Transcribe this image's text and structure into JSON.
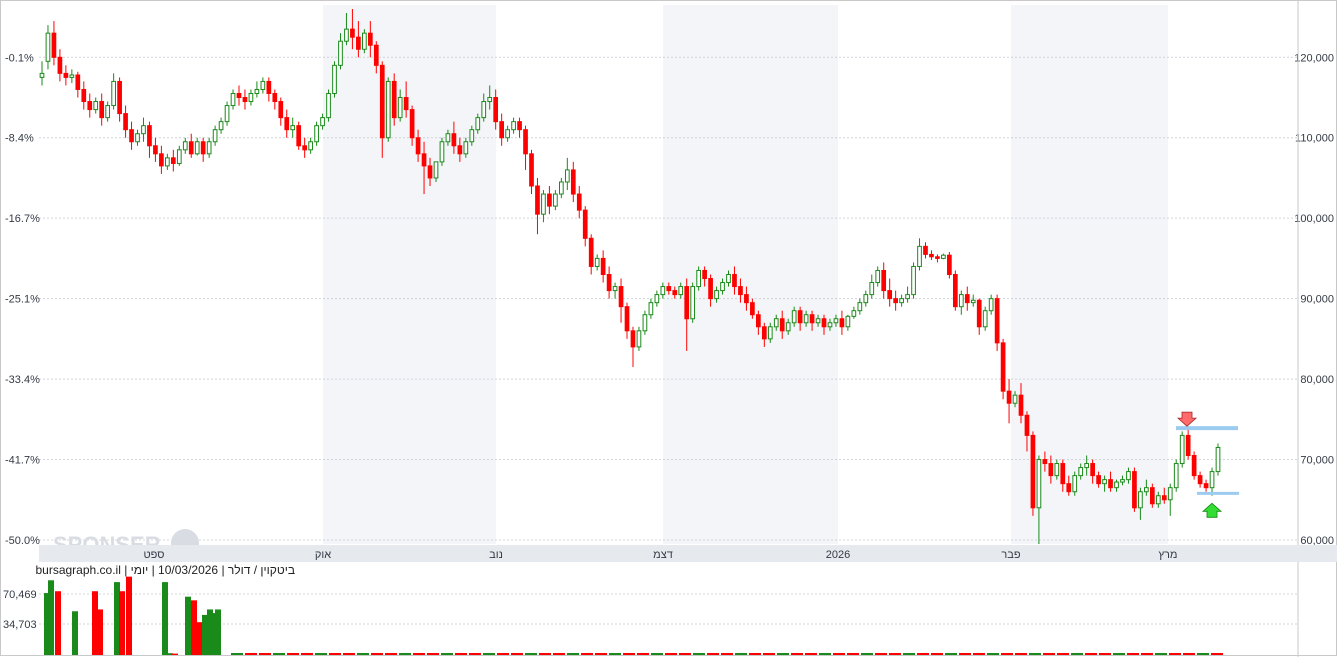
{
  "caption": "bursagraph.co.il | ביטקוין / דולר | 10/03/2026 | יומי",
  "watermark": "SPONSER",
  "colors": {
    "up": "#1a8a1a",
    "down": "#ff0000",
    "grid": "#d0d4da",
    "band": "#f3f5f8",
    "level": "#9ccbf0",
    "arrow_down": "#ff6b6b",
    "arrow_up": "#33dd33"
  },
  "chart_data": {
    "type": "candlestick",
    "ylim": [
      59500,
      126500
    ],
    "y_ticks_right": [
      "60,000",
      "70,000",
      "80,000",
      "90,000",
      "100,000",
      "110,000",
      "120,000"
    ],
    "y_ticks_left": [
      "-50.0%",
      "-41.7%",
      "-33.4%",
      "-25.1%",
      "-16.7%",
      "-8.4%",
      "-0.1%"
    ],
    "x_ticks": [
      "ספט",
      "אוק",
      "נוב",
      "דצמ",
      "2026",
      "פבר",
      "מרץ"
    ],
    "volume_ticks": [
      "70,469",
      "34,703"
    ],
    "levels": [
      73900,
      65800
    ],
    "candles": [
      [
        117500,
        119500,
        118000,
        116500
      ],
      [
        119500,
        124000,
        123000,
        118500
      ],
      [
        123000,
        124500,
        120000,
        119000
      ],
      [
        120000,
        121000,
        118000,
        117000
      ],
      [
        118000,
        119000,
        117500,
        116500
      ],
      [
        117500,
        118500,
        117800,
        116800
      ],
      [
        117800,
        118200,
        116000,
        115000
      ],
      [
        116000,
        117000,
        114500,
        113500
      ],
      [
        114500,
        115500,
        113500,
        112500
      ],
      [
        113500,
        115000,
        114500,
        113000
      ],
      [
        114500,
        115500,
        112500,
        111500
      ],
      [
        112500,
        114500,
        114000,
        112000
      ],
      [
        114000,
        118000,
        117000,
        113500
      ],
      [
        117000,
        117500,
        113000,
        112000
      ],
      [
        113000,
        114000,
        111000,
        110000
      ],
      [
        111000,
        112000,
        109500,
        108500
      ],
      [
        109500,
        111000,
        110500,
        109000
      ],
      [
        110500,
        112500,
        111500,
        109500
      ],
      [
        111500,
        112000,
        109000,
        107500
      ],
      [
        109000,
        110000,
        108000,
        107000
      ],
      [
        108000,
        109000,
        106500,
        105500
      ],
      [
        106500,
        108000,
        107500,
        106000
      ],
      [
        107500,
        108500,
        106800,
        105800
      ],
      [
        106800,
        109000,
        108500,
        106500
      ],
      [
        108500,
        110000,
        109500,
        108000
      ],
      [
        109500,
        110500,
        108000,
        107500
      ],
      [
        108000,
        110000,
        109500,
        107800
      ],
      [
        109500,
        110000,
        108000,
        107000
      ],
      [
        108000,
        110000,
        109500,
        107500
      ],
      [
        109500,
        111500,
        111000,
        109000
      ],
      [
        111000,
        112500,
        112000,
        110500
      ],
      [
        112000,
        114500,
        114000,
        111500
      ],
      [
        114000,
        116000,
        115500,
        113500
      ],
      [
        115500,
        116500,
        115000,
        114000
      ],
      [
        115000,
        116000,
        114500,
        113500
      ],
      [
        114500,
        116000,
        115500,
        114000
      ],
      [
        115500,
        117000,
        116000,
        115000
      ],
      [
        116000,
        117500,
        117000,
        115500
      ],
      [
        117000,
        117500,
        115500,
        114500
      ],
      [
        115500,
        116000,
        114500,
        113500
      ],
      [
        114500,
        115000,
        112500,
        111500
      ],
      [
        112500,
        113500,
        111000,
        110000
      ],
      [
        111000,
        112500,
        111500,
        110000
      ],
      [
        111500,
        112000,
        109000,
        108500
      ],
      [
        109000,
        110000,
        108500,
        107500
      ],
      [
        108500,
        110000,
        109500,
        108000
      ],
      [
        109500,
        112000,
        111500,
        109000
      ],
      [
        111500,
        113000,
        112500,
        111000
      ],
      [
        112500,
        116000,
        115500,
        112000
      ],
      [
        115500,
        119500,
        119000,
        115000
      ],
      [
        119000,
        123000,
        122000,
        118500
      ],
      [
        122000,
        125500,
        123500,
        121500
      ],
      [
        123500,
        126000,
        122500,
        121000
      ],
      [
        122500,
        124500,
        121000,
        120000
      ],
      [
        121000,
        123500,
        123000,
        120500
      ],
      [
        123000,
        124500,
        121500,
        120000
      ],
      [
        121500,
        122000,
        119000,
        118000
      ],
      [
        119000,
        119500,
        110000,
        107500
      ],
      [
        110000,
        117500,
        117000,
        109500
      ],
      [
        117000,
        118000,
        112500,
        111500
      ],
      [
        112500,
        116000,
        115000,
        112000
      ],
      [
        115000,
        117000,
        113500,
        112500
      ],
      [
        113500,
        114000,
        110000,
        109000
      ],
      [
        110000,
        111000,
        108000,
        107000
      ],
      [
        108000,
        109500,
        106500,
        103000
      ],
      [
        106500,
        107500,
        105000,
        104000
      ],
      [
        105000,
        106000,
        107000,
        104500
      ],
      [
        107000,
        110000,
        109500,
        106500
      ],
      [
        109500,
        111000,
        110500,
        109000
      ],
      [
        110500,
        112000,
        109000,
        108000
      ],
      [
        109000,
        110000,
        108000,
        107000
      ],
      [
        108000,
        110000,
        109500,
        107500
      ],
      [
        109500,
        111500,
        111000,
        109000
      ],
      [
        111000,
        113000,
        112500,
        110500
      ],
      [
        112500,
        115500,
        114500,
        112000
      ],
      [
        114500,
        116500,
        115000,
        113500
      ],
      [
        115000,
        116000,
        112000,
        111000
      ],
      [
        112000,
        113000,
        110000,
        109000
      ],
      [
        110000,
        111500,
        111000,
        109500
      ],
      [
        111000,
        112500,
        112000,
        110500
      ],
      [
        112000,
        112500,
        111000,
        110000
      ],
      [
        111000,
        111500,
        108000,
        106000
      ],
      [
        108000,
        108500,
        104000,
        103000
      ],
      [
        104000,
        105000,
        100500,
        98000
      ],
      [
        100500,
        103500,
        103000,
        99500
      ],
      [
        103000,
        104000,
        101500,
        100500
      ],
      [
        101500,
        103500,
        103000,
        101000
      ],
      [
        103000,
        105000,
        104500,
        102500
      ],
      [
        104500,
        107500,
        106000,
        103500
      ],
      [
        106000,
        107000,
        103000,
        102000
      ],
      [
        103000,
        104000,
        101000,
        100000
      ],
      [
        101000,
        101500,
        97500,
        96500
      ],
      [
        97500,
        98000,
        94000,
        93000
      ],
      [
        94000,
        95500,
        95000,
        93500
      ],
      [
        95000,
        96000,
        93000,
        92000
      ],
      [
        93000,
        94000,
        91000,
        90000
      ],
      [
        91000,
        92000,
        91500,
        90000
      ],
      [
        91500,
        92500,
        89000,
        87000
      ],
      [
        89000,
        89500,
        86000,
        85000
      ],
      [
        86000,
        86500,
        84000,
        81500
      ],
      [
        84000,
        86500,
        86000,
        83500
      ],
      [
        86000,
        88500,
        88000,
        85500
      ],
      [
        88000,
        90000,
        89500,
        87500
      ],
      [
        89500,
        91000,
        90500,
        89000
      ],
      [
        90500,
        92000,
        91500,
        90000
      ],
      [
        91500,
        92000,
        91000,
        90500
      ],
      [
        91000,
        91500,
        90500,
        90000
      ],
      [
        90500,
        92000,
        91500,
        90000
      ],
      [
        91500,
        92500,
        87500,
        83500
      ],
      [
        87500,
        92000,
        91500,
        87000
      ],
      [
        91500,
        94000,
        93500,
        91000
      ],
      [
        93500,
        94000,
        92500,
        91500
      ],
      [
        92500,
        93000,
        90000,
        89000
      ],
      [
        90000,
        91500,
        91000,
        89500
      ],
      [
        91000,
        92500,
        92000,
        90500
      ],
      [
        92000,
        93500,
        93000,
        91500
      ],
      [
        93000,
        94000,
        91500,
        90500
      ],
      [
        91500,
        92500,
        90500,
        89500
      ],
      [
        90500,
        91500,
        89500,
        88500
      ],
      [
        89500,
        90000,
        88000,
        87500
      ],
      [
        88000,
        88500,
        86500,
        85500
      ],
      [
        86500,
        87000,
        85000,
        84000
      ],
      [
        85000,
        87000,
        86500,
        84500
      ],
      [
        86500,
        88000,
        87500,
        86000
      ],
      [
        87500,
        88500,
        86000,
        85000
      ],
      [
        86000,
        87500,
        87000,
        85500
      ],
      [
        87000,
        89000,
        88500,
        86500
      ],
      [
        88500,
        89000,
        87000,
        86000
      ],
      [
        87000,
        88500,
        88000,
        86500
      ],
      [
        88000,
        88500,
        87000,
        86000
      ],
      [
        87000,
        88000,
        87500,
        86500
      ],
      [
        87500,
        88000,
        86500,
        85500
      ],
      [
        86500,
        87500,
        87000,
        86000
      ],
      [
        87000,
        88000,
        87500,
        86500
      ],
      [
        87500,
        88500,
        86500,
        85500
      ],
      [
        86500,
        88000,
        87800,
        86000
      ],
      [
        87800,
        89000,
        88500,
        87500
      ],
      [
        88500,
        90000,
        89500,
        88000
      ],
      [
        89500,
        91000,
        90500,
        89000
      ],
      [
        90500,
        93000,
        92000,
        90000
      ],
      [
        92000,
        94000,
        93500,
        91500
      ],
      [
        93500,
        94500,
        91000,
        90000
      ],
      [
        91000,
        92500,
        90000,
        89000
      ],
      [
        90000,
        91000,
        89500,
        88500
      ],
      [
        89500,
        90500,
        90000,
        89000
      ],
      [
        90000,
        91500,
        90500,
        89500
      ],
      [
        90500,
        94500,
        94000,
        90000
      ],
      [
        94000,
        97500,
        96500,
        93500
      ],
      [
        96500,
        97000,
        95500,
        95000
      ],
      [
        95500,
        96000,
        95200,
        94800
      ],
      [
        95200,
        95500,
        95000,
        94500
      ],
      [
        95000,
        95600,
        95400,
        94900
      ],
      [
        95400,
        95800,
        93000,
        92500
      ],
      [
        93000,
        93500,
        89000,
        88500
      ],
      [
        89000,
        91000,
        90500,
        88000
      ],
      [
        90500,
        91500,
        89500,
        88500
      ],
      [
        89500,
        90500,
        89800,
        89000
      ],
      [
        89800,
        90000,
        86500,
        85500
      ],
      [
        86500,
        89000,
        88500,
        86000
      ],
      [
        88500,
        90500,
        90000,
        88000
      ],
      [
        90000,
        90500,
        84500,
        83500
      ],
      [
        84500,
        85000,
        78500,
        77500
      ],
      [
        78500,
        80000,
        77000,
        74500
      ],
      [
        77000,
        78500,
        78000,
        76500
      ],
      [
        78000,
        79500,
        75500,
        74500
      ],
      [
        75500,
        76000,
        73000,
        71000
      ],
      [
        73000,
        73500,
        64000,
        63000
      ],
      [
        64000,
        70500,
        70000,
        59500
      ],
      [
        70000,
        71000,
        69500,
        68500
      ],
      [
        69500,
        70500,
        68000,
        67000
      ],
      [
        68000,
        70000,
        69500,
        67500
      ],
      [
        69500,
        70000,
        67000,
        66000
      ],
      [
        67000,
        68000,
        66000,
        65500
      ],
      [
        66000,
        68500,
        68000,
        65500
      ],
      [
        68000,
        69500,
        69000,
        67500
      ],
      [
        69000,
        70500,
        69500,
        68000
      ],
      [
        69500,
        70000,
        68000,
        67000
      ],
      [
        68000,
        68500,
        67000,
        66500
      ],
      [
        67000,
        68000,
        67500,
        66000
      ],
      [
        67500,
        68500,
        66500,
        66000
      ],
      [
        66500,
        67500,
        67200,
        66000
      ],
      [
        67200,
        68000,
        67500,
        66800
      ],
      [
        67500,
        69000,
        68500,
        67000
      ],
      [
        68500,
        69000,
        64000,
        63500
      ],
      [
        64000,
        66500,
        66000,
        62500
      ],
      [
        66000,
        67500,
        66500,
        65500
      ],
      [
        66500,
        67000,
        64500,
        64000
      ],
      [
        64500,
        66000,
        65500,
        64000
      ],
      [
        65500,
        66500,
        65000,
        64500
      ],
      [
        65000,
        67000,
        66500,
        63000
      ],
      [
        66500,
        70000,
        69500,
        66000
      ],
      [
        69500,
        73500,
        73000,
        69000
      ],
      [
        73000,
        73800,
        70500,
        70000
      ],
      [
        70500,
        71000,
        68000,
        67500
      ],
      [
        68000,
        68500,
        67000,
        66500
      ],
      [
        67000,
        67500,
        66500,
        66000
      ],
      [
        66500,
        69000,
        68500,
        65500
      ],
      [
        68500,
        72000,
        71500,
        68000
      ]
    ],
    "volume_left": [
      [
        68000,
        "up"
      ],
      [
        82000,
        "up"
      ],
      [
        70000,
        "down"
      ],
      [
        48000,
        "up"
      ],
      [
        70000,
        "down"
      ],
      [
        50000,
        "down"
      ],
      [
        80000,
        "up"
      ],
      [
        70000,
        "down"
      ],
      [
        86000,
        "down"
      ],
      [
        80000,
        "up"
      ],
      [
        2000,
        "up"
      ],
      [
        1500,
        "down"
      ],
      [
        64000,
        "up"
      ],
      [
        60000,
        "down"
      ],
      [
        36000,
        "down"
      ],
      [
        44000,
        "up"
      ],
      [
        50000,
        "up"
      ],
      [
        46000,
        "up"
      ],
      [
        50000,
        "up"
      ]
    ]
  }
}
